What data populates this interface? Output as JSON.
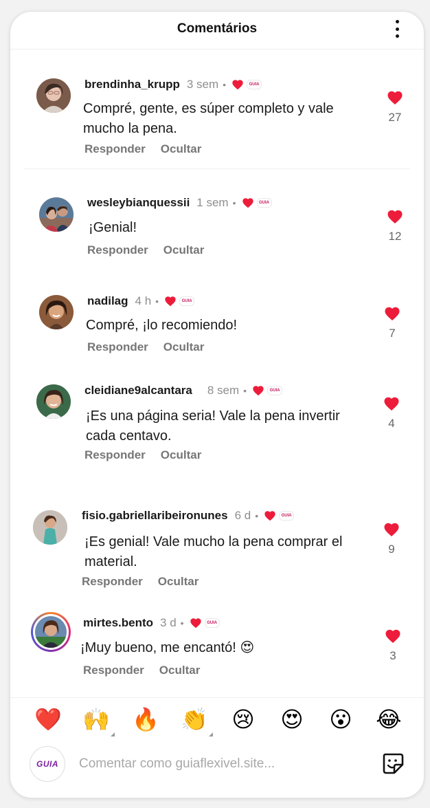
{
  "header": {
    "title": "Comentários"
  },
  "comments": [
    {
      "username": "brendinha_krupp",
      "time": "3 sem",
      "dot": "•",
      "text": "Compré, gente, es súper completo y vale mucho la pena.",
      "reply": "Responder",
      "hide": "Ocultar",
      "likes": "27"
    },
    {
      "username": "wesleybianquessii",
      "time": "1 sem",
      "dot": "•",
      "text": "¡Genial!",
      "reply": "Responder",
      "hide": "Ocultar",
      "likes": "12"
    },
    {
      "username": "nadilag",
      "time": "4 h",
      "dot": "•",
      "text": "Compré, ¡lo recomiendo!",
      "reply": "Responder",
      "hide": "Ocultar",
      "likes": "7"
    },
    {
      "username": "cleidiane9alcantara",
      "time": "8 sem",
      "dot": "•",
      "text": "¡Es una página seria! Vale la pena invertir cada centavo.",
      "reply": "Responder",
      "hide": "Ocultar",
      "likes": "4"
    },
    {
      "username": "fisio.gabriellaribeironunes",
      "time": "6 d",
      "dot": "•",
      "text": "¡Es genial! Vale mucho la pena comprar el material.",
      "reply": "Responder",
      "hide": "Ocultar",
      "likes": "9"
    },
    {
      "username": "mirtes.bento",
      "time": "3 d",
      "dot": "•",
      "text": "¡Muy bueno, me encantó! 😍",
      "reply": "Responder",
      "hide": "Ocultar",
      "likes": "3"
    }
  ],
  "badge_text": "GUIA",
  "reactions": [
    "❤️",
    "🙌",
    "🔥",
    "👏",
    "😢",
    "😍",
    "😮",
    "😂"
  ],
  "composer": {
    "avatar_text": "GUIA",
    "placeholder": "Comentar como guiaflexivel.site..."
  },
  "colors": {
    "heart": "#ed1c3a",
    "muted": "#8e8e8e",
    "action": "#767676"
  },
  "icons": {
    "more": "more-vertical-icon",
    "like": "heart-icon",
    "sticker": "sticker-icon"
  }
}
